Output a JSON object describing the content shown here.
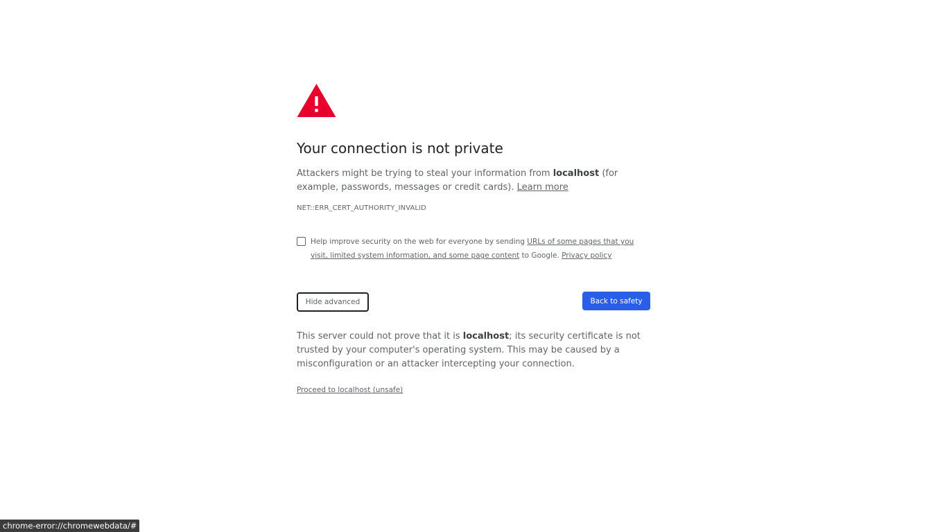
{
  "interstitial": {
    "icon": "warning-triangle-icon",
    "icon_color": "#e8002d",
    "title": "Your connection is not private",
    "explanation": {
      "prefix": "Attackers might be trying to steal your information from ",
      "host": "localhost",
      "suffix": " (for example, passwords, messages or credit cards). ",
      "learn_more": "Learn more"
    },
    "error_code": "NET::ERR_CERT_AUTHORITY_INVALID",
    "optin": {
      "checked": false,
      "prefix": "Help improve security on the web for everyone by sending ",
      "link": "URLs of some pages that you visit, limited system information, and some page content",
      "middle": " to Google. ",
      "privacy_policy": "Privacy policy"
    },
    "hide_advanced_label": "Hide advanced",
    "back_to_safety_label": "Back to safety",
    "primary_color": "#2a5ee8",
    "details": {
      "prefix": "This server could not prove that it is ",
      "host": "localhost",
      "suffix": "; its security certificate is not trusted by your computer's operating system. This may be caused by a misconfiguration or an attacker intercepting your connection."
    },
    "proceed_link": "Proceed to localhost (unsafe)"
  },
  "status_bar": {
    "url": "chrome-error://chromewebdata/#"
  }
}
